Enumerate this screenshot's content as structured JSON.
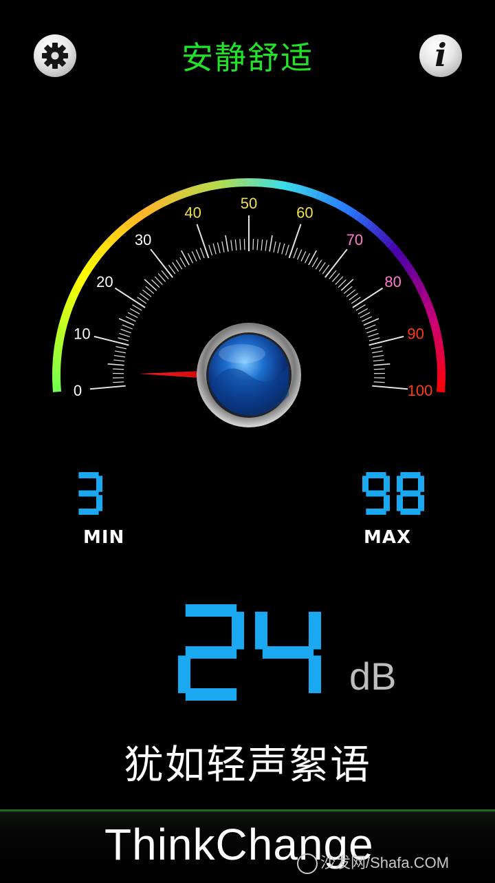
{
  "header": {
    "status_title": "安静舒适",
    "settings_icon": "gear-icon",
    "info_icon": "info-icon",
    "info_glyph": "i"
  },
  "gauge": {
    "tick_labels": [
      "0",
      "10",
      "20",
      "30",
      "40",
      "50",
      "60",
      "70",
      "80",
      "90",
      "100"
    ],
    "scale_min": 0,
    "scale_max": 100,
    "needle_value": 3,
    "label_colors": [
      "#ffffff",
      "#ffffff",
      "#ffffff",
      "#ffffff",
      "#f2e14a",
      "#f2e14a",
      "#f2e14a",
      "#ff7bd0",
      "#ff7bd0",
      "#ff3b1a",
      "#ff3b1a"
    ]
  },
  "stats": {
    "min_value": "3",
    "min_label": "MIN",
    "max_value": "98",
    "max_label": "MAX"
  },
  "reading": {
    "value": "24",
    "unit": "dB",
    "description": "犹如轻声絮语"
  },
  "footer": {
    "brand": "ThinkChange",
    "watermark": "沙发网/Shafa.COM"
  },
  "colors": {
    "lcd": "#1aa8f0",
    "title_green": "#22e22a"
  }
}
